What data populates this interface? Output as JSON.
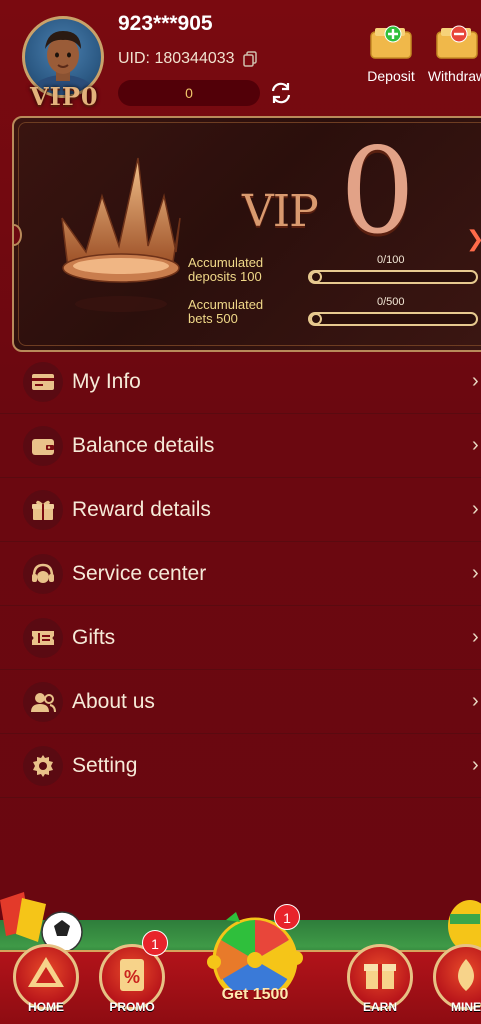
{
  "user": {
    "name": "923***905",
    "uid_label": "UID: 180344033",
    "balance": "0",
    "vip_badge": "VIP0"
  },
  "actions": {
    "deposit": "Deposit",
    "withdraw": "Withdraw"
  },
  "vip_card": {
    "vip_word": "VIP",
    "level": "0",
    "deposits_label": "Accumulated deposits 100",
    "deposits_line1": "Accumulated",
    "deposits_line2": "deposits 100",
    "deposits_progress": "0/100",
    "deposits_fraction": 0,
    "bets_line1": "Accumulated",
    "bets_line2": "bets 500",
    "bets_progress": "0/500",
    "bets_fraction": 0
  },
  "menu": {
    "items": [
      {
        "label": "My Info",
        "icon": "card-icon"
      },
      {
        "label": "Balance details",
        "icon": "wallet-icon"
      },
      {
        "label": "Reward details",
        "icon": "gift-icon"
      },
      {
        "label": "Service center",
        "icon": "headset-icon"
      },
      {
        "label": "Gifts",
        "icon": "ticket-icon"
      },
      {
        "label": "About us",
        "icon": "users-icon"
      },
      {
        "label": "Setting",
        "icon": "gear-icon"
      }
    ]
  },
  "nav": {
    "home": "HOME",
    "promo": "PROMO",
    "promo_badge": "1",
    "wheel": "Get 1500",
    "wheel_badge": "1",
    "earn": "EARN",
    "mine": "MINE"
  },
  "colors": {
    "background": "#6b0810",
    "accent_gold": "#e7c98f",
    "vip_text": "#e2a287",
    "badge_red": "#e8232b"
  }
}
